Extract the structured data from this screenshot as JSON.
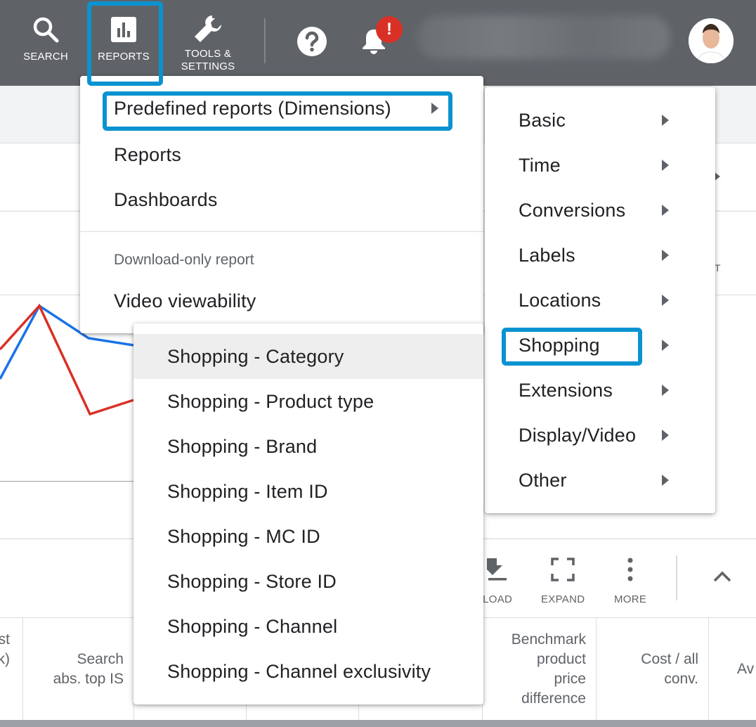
{
  "topbar": {
    "nav": [
      {
        "label": "SEARCH",
        "icon": "search-icon"
      },
      {
        "label": "REPORTS",
        "icon": "reports-icon"
      },
      {
        "label_line1": "TOOLS &",
        "label_line2": "SETTINGS",
        "icon": "wrench-icon"
      }
    ],
    "help_icon": "help-icon",
    "notification_icon": "bell-icon",
    "notification_badge": "!"
  },
  "reports_menu": {
    "items": [
      {
        "label": "Predefined reports (Dimensions)",
        "has_submenu": true
      },
      {
        "label": "Reports"
      },
      {
        "label": "Dashboards"
      }
    ],
    "section_label": "Download-only report",
    "section_items": [
      {
        "label": "Video viewability"
      }
    ]
  },
  "dimensions_menu": {
    "items": [
      {
        "label": "Basic"
      },
      {
        "label": "Time"
      },
      {
        "label": "Conversions"
      },
      {
        "label": "Labels"
      },
      {
        "label": "Locations"
      },
      {
        "label": "Shopping"
      },
      {
        "label": "Extensions"
      },
      {
        "label": "Display/Video"
      },
      {
        "label": "Other"
      }
    ]
  },
  "shopping_menu": {
    "items": [
      {
        "label": "Shopping - Category"
      },
      {
        "label": "Shopping - Product type"
      },
      {
        "label": "Shopping - Brand"
      },
      {
        "label": "Shopping - Item ID"
      },
      {
        "label": "Shopping - MC ID"
      },
      {
        "label": "Shopping - Store ID"
      },
      {
        "label": "Shopping - Channel"
      },
      {
        "label": "Shopping - Channel exclusivity"
      }
    ]
  },
  "toolbar": {
    "download_label": "NLOAD",
    "expand_label": "EXPAND",
    "more_label": "MORE"
  },
  "table_headers": {
    "col0": [
      "st",
      "k)"
    ],
    "col1": [
      "Search",
      "abs. top IS"
    ],
    "col2": [
      "Benchmark",
      "product",
      "price",
      "difference"
    ],
    "col3": [
      "Cost / all",
      "conv."
    ],
    "col4": [
      "Av"
    ]
  },
  "chart": {
    "axis_fragment": "T",
    "colors": {
      "series_blue": "#1a73e8",
      "series_red": "#d93025"
    }
  },
  "colors": {
    "topbar": "#5f6368",
    "highlight": "#0a93d0",
    "badge": "#d93025"
  }
}
